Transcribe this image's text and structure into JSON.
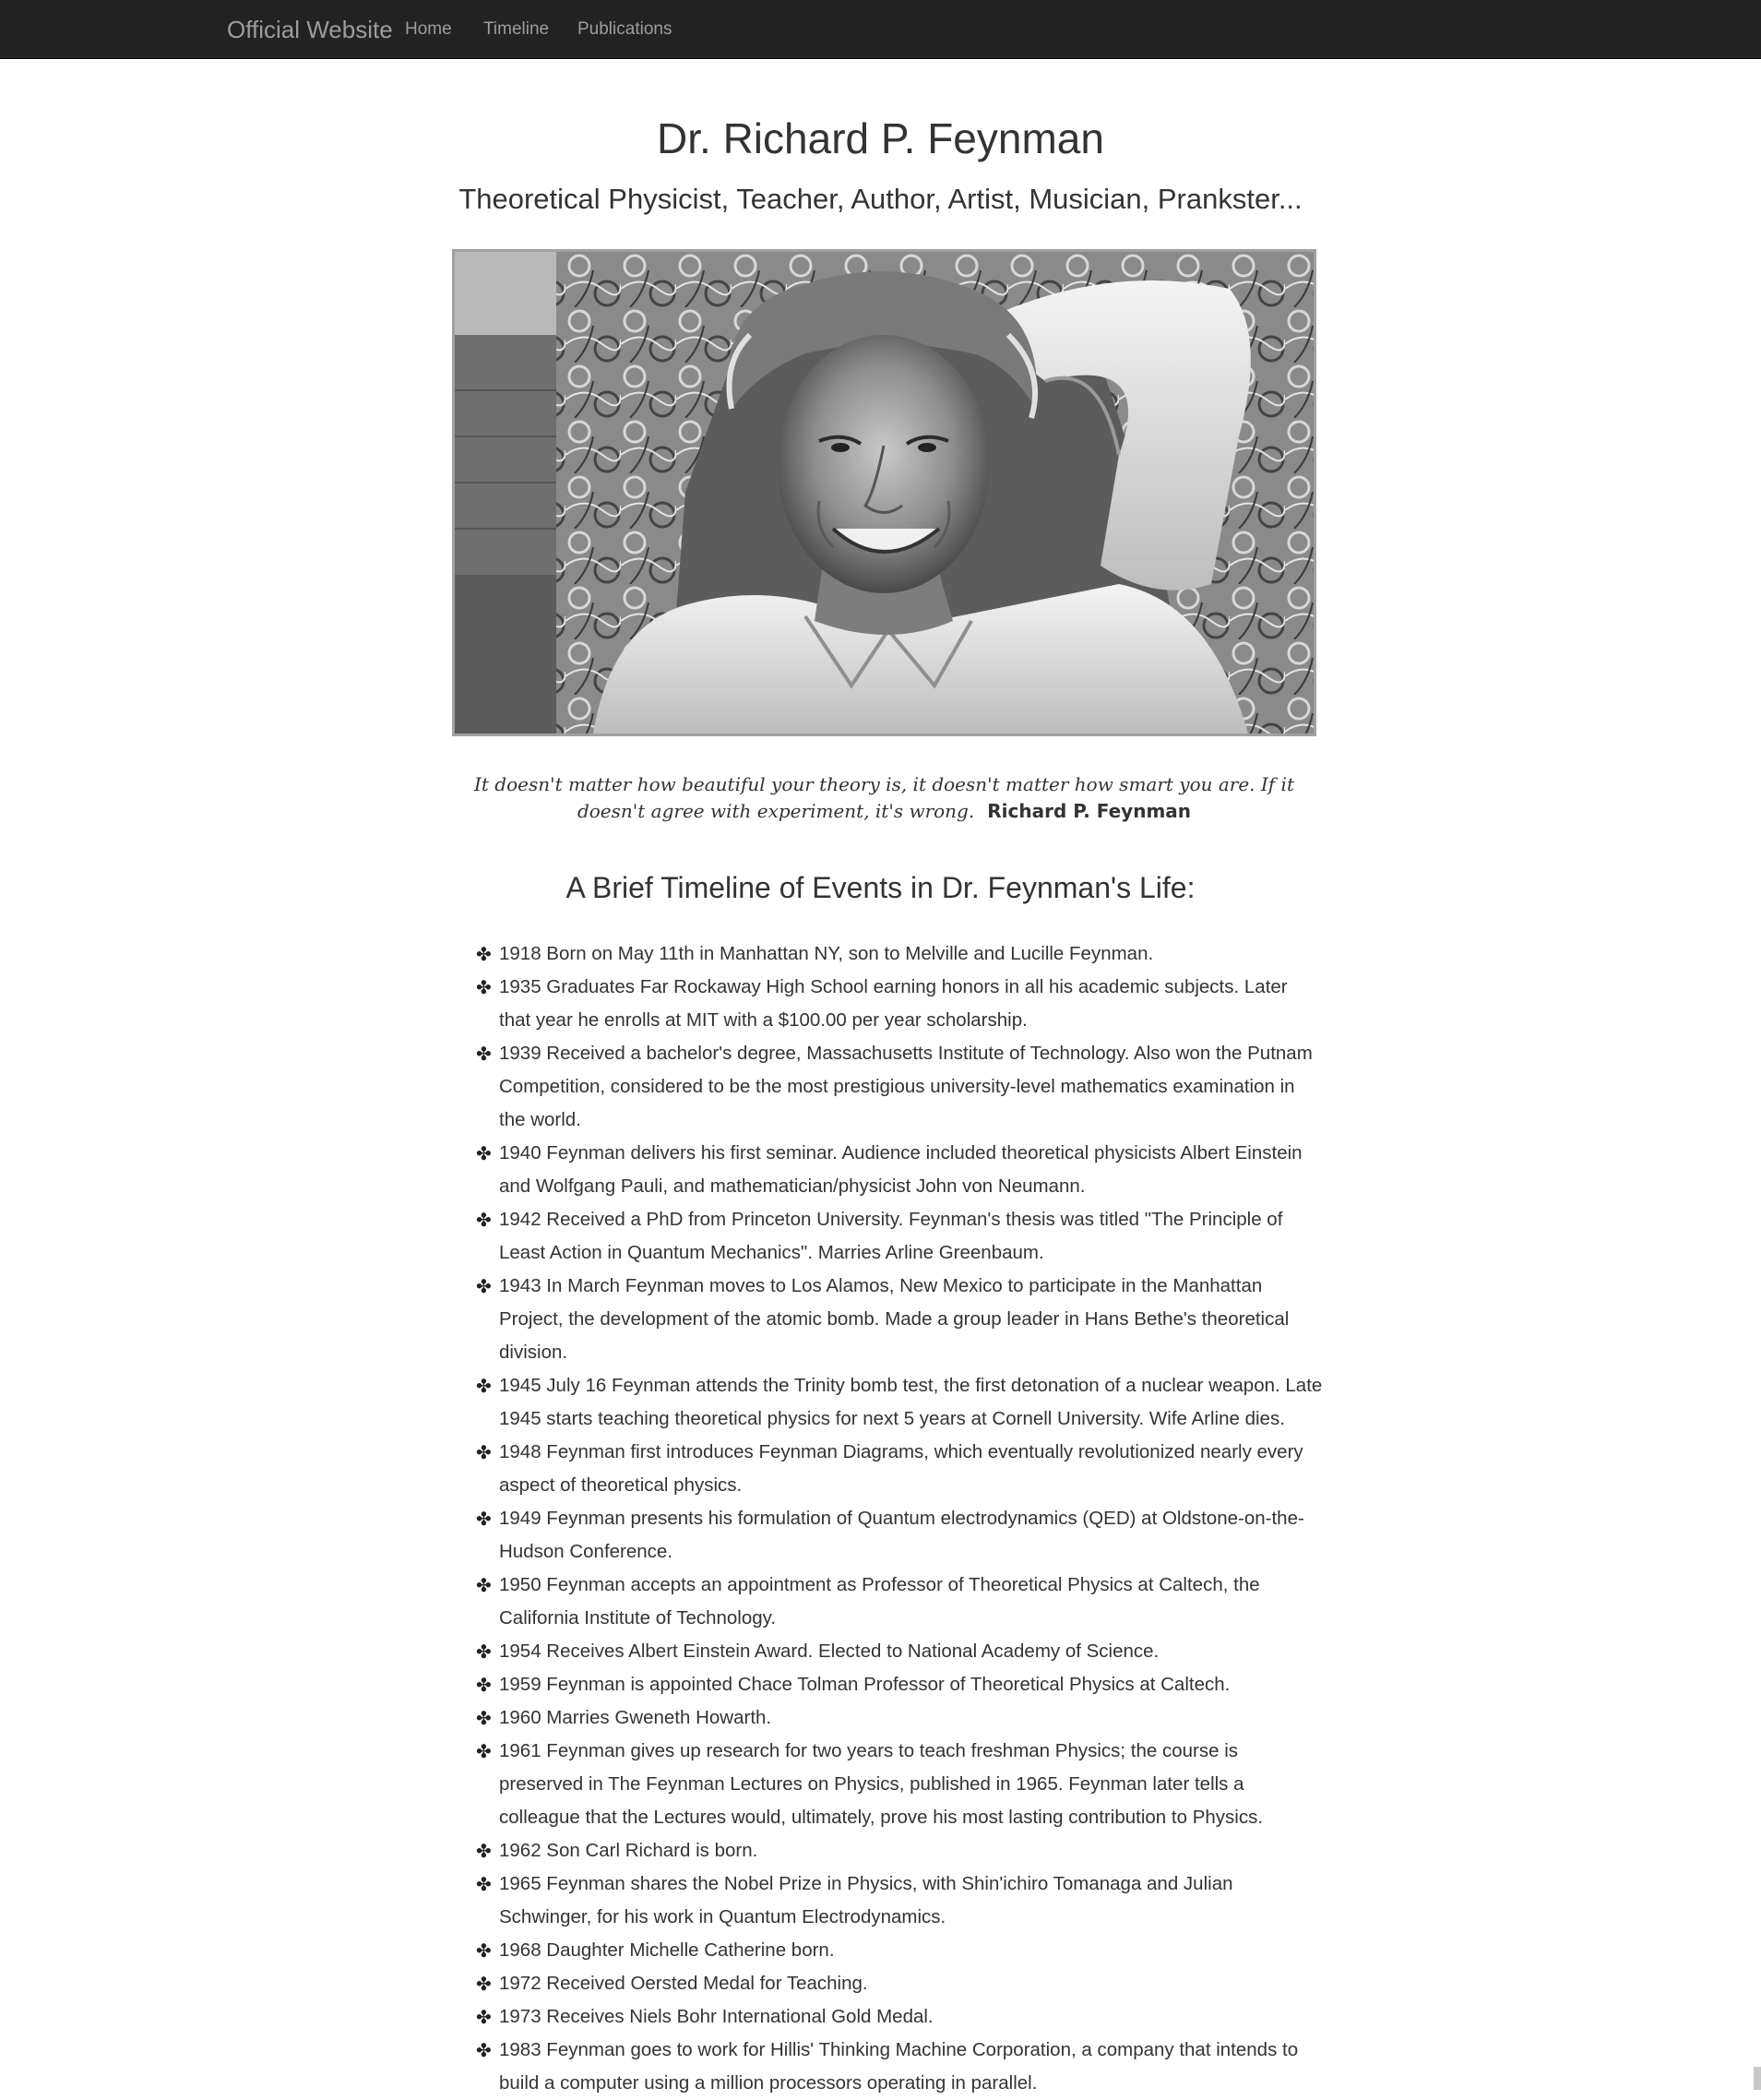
{
  "navbar": {
    "brand": "Official Website",
    "links": [
      "Home",
      "Timeline",
      "Publications"
    ]
  },
  "header": {
    "title": "Dr. Richard P. Feynman",
    "subtitle": "Theoretical Physicist, Teacher, Author, Artist, Musician, Prankster..."
  },
  "quote": {
    "text": "It doesn't matter how beautiful your theory is, it doesn't matter how smart you are. If it doesn't agree with experiment, it's wrong.",
    "author": "Richard P. Feynman"
  },
  "timeline": {
    "heading": "A Brief Timeline of Events in Dr. Feynman's Life:",
    "bullet": "✤",
    "items": [
      "1918 Born on May 11th in Manhattan NY, son to Melville and Lucille Feynman.",
      "1935 Graduates Far Rockaway High School earning honors in all his academic subjects. Later that year he enrolls at MIT with a $100.00 per year scholarship.",
      "1939 Received a bachelor's degree, Massachusetts Institute of Technology. Also won the Putnam Competition, considered to be the most prestigious university-level mathematics examination in the world.",
      "1940 Feynman delivers his first seminar. Audience included theoretical physicists Albert Einstein and Wolfgang Pauli, and mathematician/physicist John von Neumann.",
      "1942 Received a PhD from Princeton University. Feynman's thesis was titled \"The Principle of Least Action in Quantum Mechanics\". Marries Arline Greenbaum.",
      "1943 In March Feynman moves to Los Alamos, New Mexico to participate in the Manhattan Project, the development of the atomic bomb. Made a group leader in Hans Bethe's theoretical division.",
      "1945 July 16 Feynman attends the Trinity bomb test, the first detonation of a nuclear weapon. Late 1945 starts teaching theoretical physics for next 5 years at Cornell University. Wife Arline dies.",
      "1948 Feynman first introduces Feynman Diagrams, which eventually revolutionized nearly every aspect of theoretical physics.",
      "1949 Feynman presents his formulation of Quantum electrodynamics (QED) at Oldstone-on-the-Hudson Conference.",
      "1950 Feynman accepts an appointment as Professor of Theoretical Physics at Caltech, the California Institute of Technology.",
      "1954 Receives Albert Einstein Award. Elected to National Academy of Science.",
      "1959 Feynman is appointed Chace Tolman Professor of Theoretical Physics at Caltech.",
      "1960 Marries Gweneth Howarth.",
      "1961 Feynman gives up research for two years to teach freshman Physics; the course is preserved in The Feynman Lectures on Physics, published in 1965. Feynman later tells a colleague that the Lectures would, ultimately, prove his most lasting contribution to Physics.",
      "1962 Son Carl Richard is born.",
      "1965 Feynman shares the Nobel Prize in Physics, with Shin'ichiro Tomanaga and Julian Schwinger, for his work in Quantum Electrodynamics.",
      "1968 Daughter Michelle Catherine born.",
      "1972 Received Oersted Medal for Teaching.",
      "1973 Receives Niels Bohr International Gold Medal.",
      "1983 Feynman goes to work for Hillis' Thinking Machine Corporation, a company that intends to build a computer using a million processors operating in parallel."
    ]
  }
}
